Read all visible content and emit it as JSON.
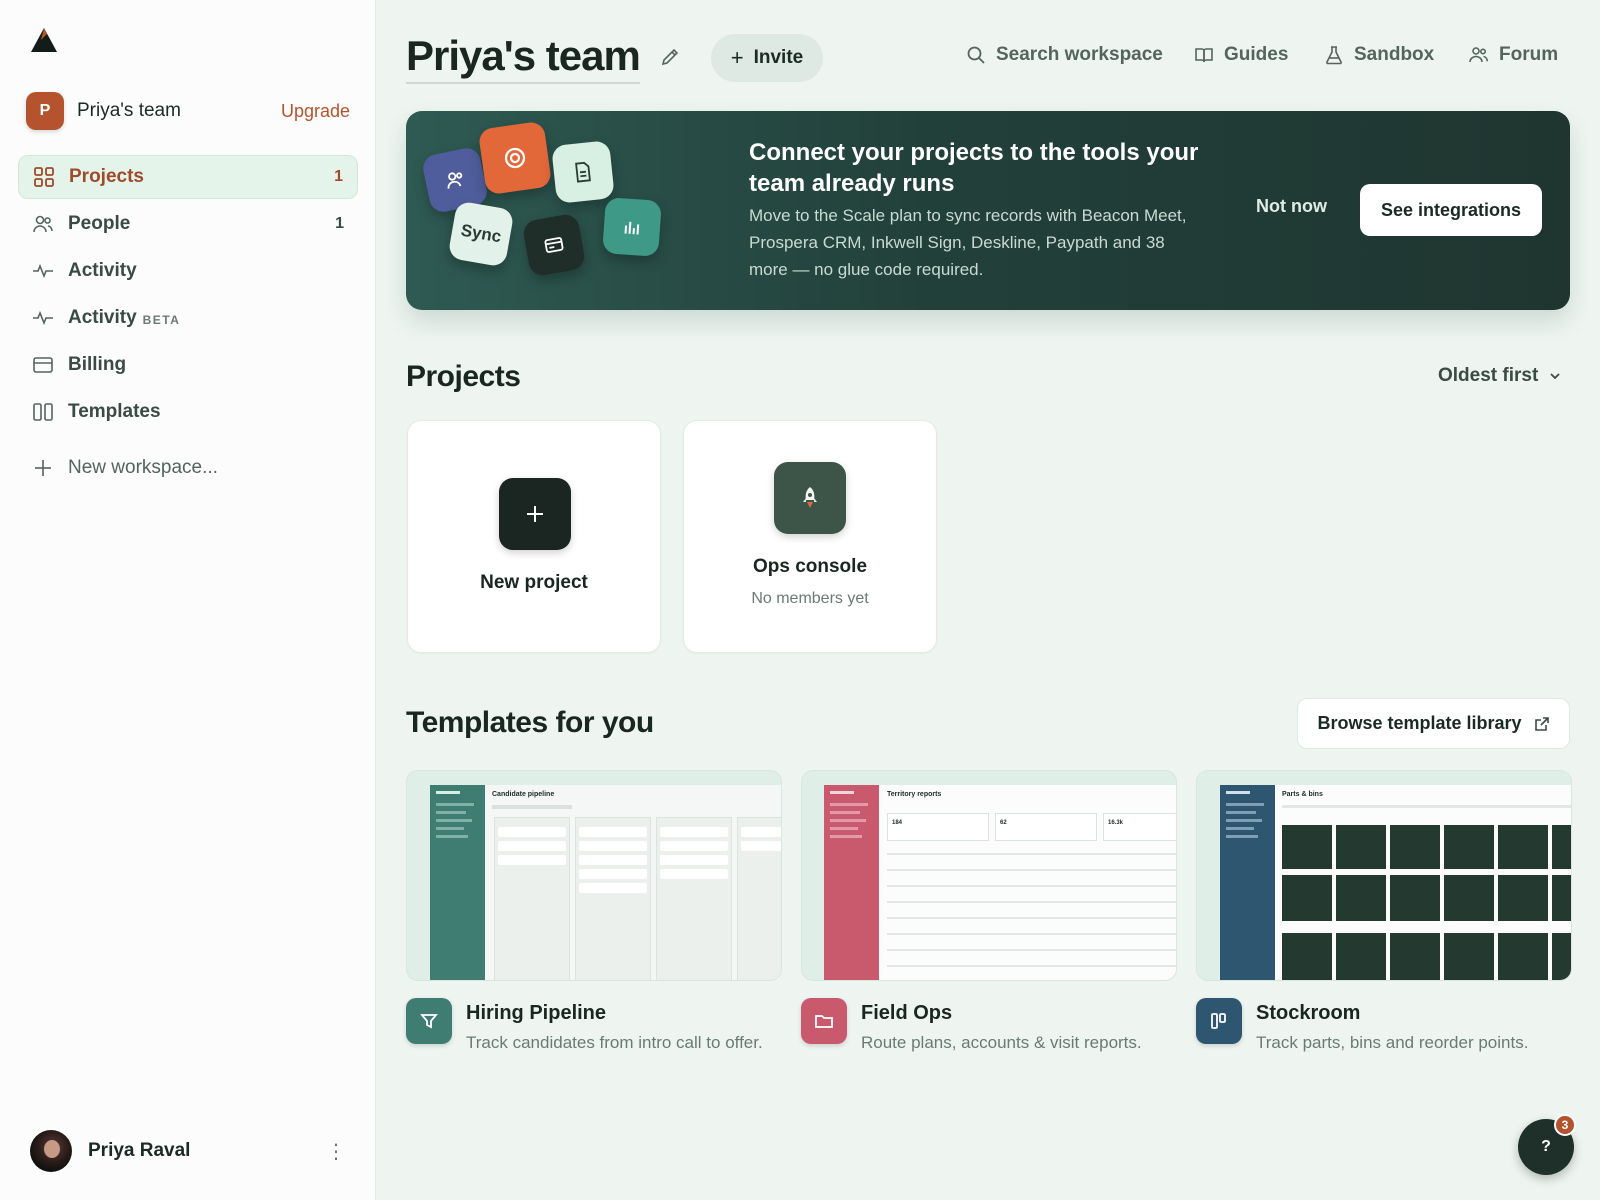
{
  "sidebar": {
    "team_initial": "P",
    "team_name": "Priya's team",
    "upgrade_label": "Upgrade",
    "nav": [
      {
        "label": "Projects",
        "count": "1",
        "icon": "grid-icon"
      },
      {
        "label": "People",
        "count": "1",
        "icon": "people-icon"
      },
      {
        "label": "Activity",
        "icon": "activity-icon"
      },
      {
        "label": "Activity",
        "badge": "BETA",
        "icon": "activity-icon"
      },
      {
        "label": "Billing",
        "icon": "card-icon"
      },
      {
        "label": "Templates",
        "icon": "columns-icon"
      }
    ],
    "new_workspace_label": "New workspace...",
    "user_name": "Priya Raval"
  },
  "header": {
    "title": "Priya's team",
    "invite_label": "Invite",
    "search_label": "Search workspace",
    "guides_label": "Guides",
    "sandbox_label": "Sandbox",
    "forum_label": "Forum"
  },
  "banner": {
    "title": "Connect your projects to the tools your team already runs",
    "description": "Move to the Scale plan to sync records with Beacon Meet, Prospera CRM, Inkwell Sign, Deskline, Paypath and 38 more — no glue code required.",
    "tile_sync_label": "Sync",
    "not_now_label": "Not now",
    "cta_label": "See integrations"
  },
  "projects": {
    "title": "Projects",
    "sort_label": "Oldest first",
    "new_project_label": "New project",
    "items": [
      {
        "name": "Ops console",
        "subtitle": "No members yet"
      }
    ]
  },
  "templates": {
    "title": "Templates for you",
    "browse_label": "Browse template library",
    "items": [
      {
        "name": "Hiring Pipeline",
        "description": "Track candidates from intro call to offer.",
        "preview_title": "Candidate pipeline",
        "color": "#3f7d72"
      },
      {
        "name": "Field Ops",
        "description": "Route plans, accounts & visit reports.",
        "preview_title": "Territory reports",
        "color": "#c95a6e",
        "stats": [
          "184",
          "62",
          "16.3k"
        ]
      },
      {
        "name": "Stockroom",
        "description": "Track parts, bins and reorder points.",
        "preview_title": "Parts & bins",
        "color": "#2f5670"
      }
    ]
  },
  "help": {
    "label": "?",
    "badge": "3"
  },
  "colors": {
    "accent": "#b4532d",
    "banner": "#22403a",
    "background": "#eef5f1"
  }
}
